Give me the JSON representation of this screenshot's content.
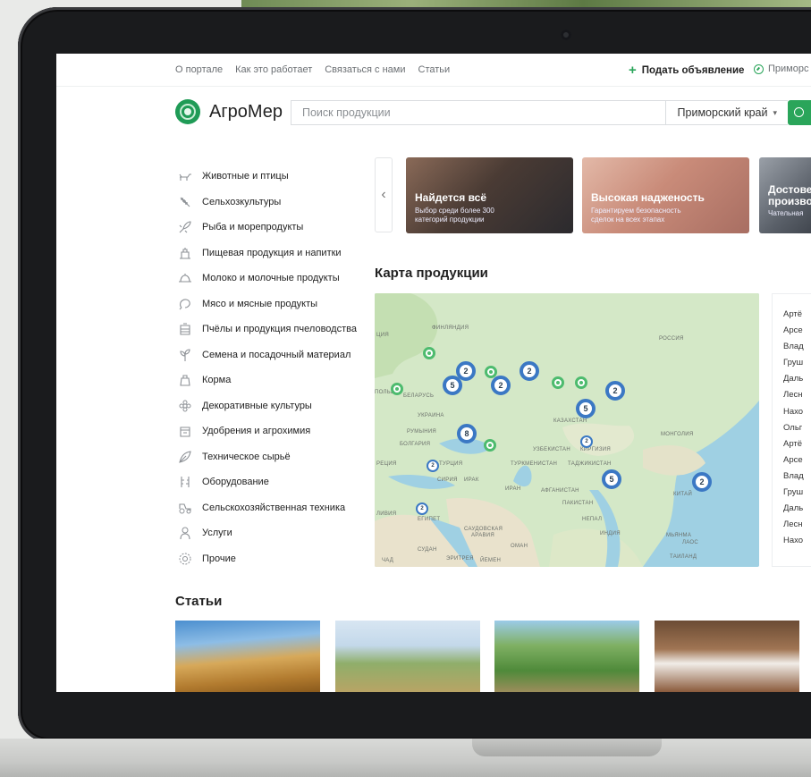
{
  "top_nav": {
    "links": [
      "О портале",
      "Как это работает",
      "Связаться с нами",
      "Статьи"
    ],
    "post_ad": "Подать объявление",
    "region": "Приморс"
  },
  "header": {
    "logo_text": "АгроМер",
    "search_placeholder": "Поиск продукции",
    "region_select": "Приморский край"
  },
  "categories": [
    {
      "label": "Животные и птицы",
      "icon": "animals-icon"
    },
    {
      "label": "Сельхозкультуры",
      "icon": "wheat-icon"
    },
    {
      "label": "Рыба и морепродукты",
      "icon": "fish-icon"
    },
    {
      "label": "Пищевая продукция и напитки",
      "icon": "food-icon"
    },
    {
      "label": "Молоко и молочные продукты",
      "icon": "milk-icon"
    },
    {
      "label": "Мясо и мясные продукты",
      "icon": "meat-icon"
    },
    {
      "label": "Пчёлы и продукция пчеловодства",
      "icon": "bee-icon"
    },
    {
      "label": "Семена и посадочный материал",
      "icon": "seedling-icon"
    },
    {
      "label": "Корма",
      "icon": "feed-icon"
    },
    {
      "label": "Декоративные культуры",
      "icon": "flower-icon"
    },
    {
      "label": "Удобрения и агрохимия",
      "icon": "fertilizer-icon"
    },
    {
      "label": "Техническое сырьё",
      "icon": "leaf-icon"
    },
    {
      "label": "Оборудование",
      "icon": "equipment-icon"
    },
    {
      "label": "Сельскохозяйственная техника",
      "icon": "tractor-icon"
    },
    {
      "label": "Услуги",
      "icon": "services-icon"
    },
    {
      "label": "Прочие",
      "icon": "gear-icon"
    }
  ],
  "banners": [
    {
      "title": "Найдется всё",
      "sub1": "Выбор среди более 300",
      "sub2": "категорий продукции"
    },
    {
      "title": "Высокая надженость",
      "sub1": "Гарантируем безопасность",
      "sub2": "сделок на всех этапах"
    },
    {
      "title": "Достове",
      "title2": "произво",
      "sub1": "Чательная"
    }
  ],
  "map_section": {
    "title": "Карта продукции",
    "labels": {
      "finland": "ФИНЛЯНДИЯ",
      "russia": "РОССИЯ",
      "ciya": "ЦИЯ",
      "poland": "ПОЛЬША",
      "belarus": "БЕЛАРУСЬ",
      "ukraine": "УКРАИНА",
      "romania": "РУМЫНИЯ",
      "bulgaria": "БОЛГАРИЯ",
      "kazakhstan": "КАЗАХСТАН",
      "mongolia": "МОНГОЛИЯ",
      "uzbekistan": "УЗБЕКИСТАН",
      "kyrgyzstan": "КИРГИЗИЯ",
      "turkey": "ТУРЦИЯ",
      "greece": "РЕЦИЯ",
      "turkmenistan": "ТУРКМЕНИСТАН",
      "tajikistan": "ТАДЖИКИСТАН",
      "syria": "СИРИЯ",
      "iraq": "ИРАК",
      "iran": "ИРАН",
      "afghanistan": "АФГАНИСТАН",
      "pakistan": "ПАКИСТАН",
      "china": "КИТАЙ",
      "libya": "ЛИВИЯ",
      "egypt": "ЕГИПЕТ",
      "saudi": "САУДОВСКАЯ",
      "saudi2": "АРАВИЯ",
      "nepal": "НЕПАЛ",
      "india": "ИНДИЯ",
      "oman": "ОМАН",
      "sudan": "СУДАН",
      "chad": "ЧАД",
      "eritrea": "ЭРИТРЕЯ",
      "yemen": "ЙЕМЕН",
      "myanmar": "МЬЯНМА",
      "laos": "ЛАОС",
      "thailand": "ТАИЛАНД"
    },
    "clusters": [
      "2",
      "5",
      "2",
      "2",
      "2",
      "5",
      "8",
      "2",
      "2",
      "5",
      "2",
      "2"
    ],
    "cities": [
      "Артё",
      "Арсе",
      "Влад",
      "Груш",
      "Даль",
      "Лесн",
      "Нахо",
      "Ольг",
      "Артё",
      "Арсе",
      "Влад",
      "Груш",
      "Даль",
      "Лесн",
      "Нахо"
    ]
  },
  "articles": {
    "title": "Статьи"
  },
  "colors": {
    "accent": "#2aa55a",
    "cluster": "#3b78c4",
    "marker": "#4dbb6e"
  }
}
